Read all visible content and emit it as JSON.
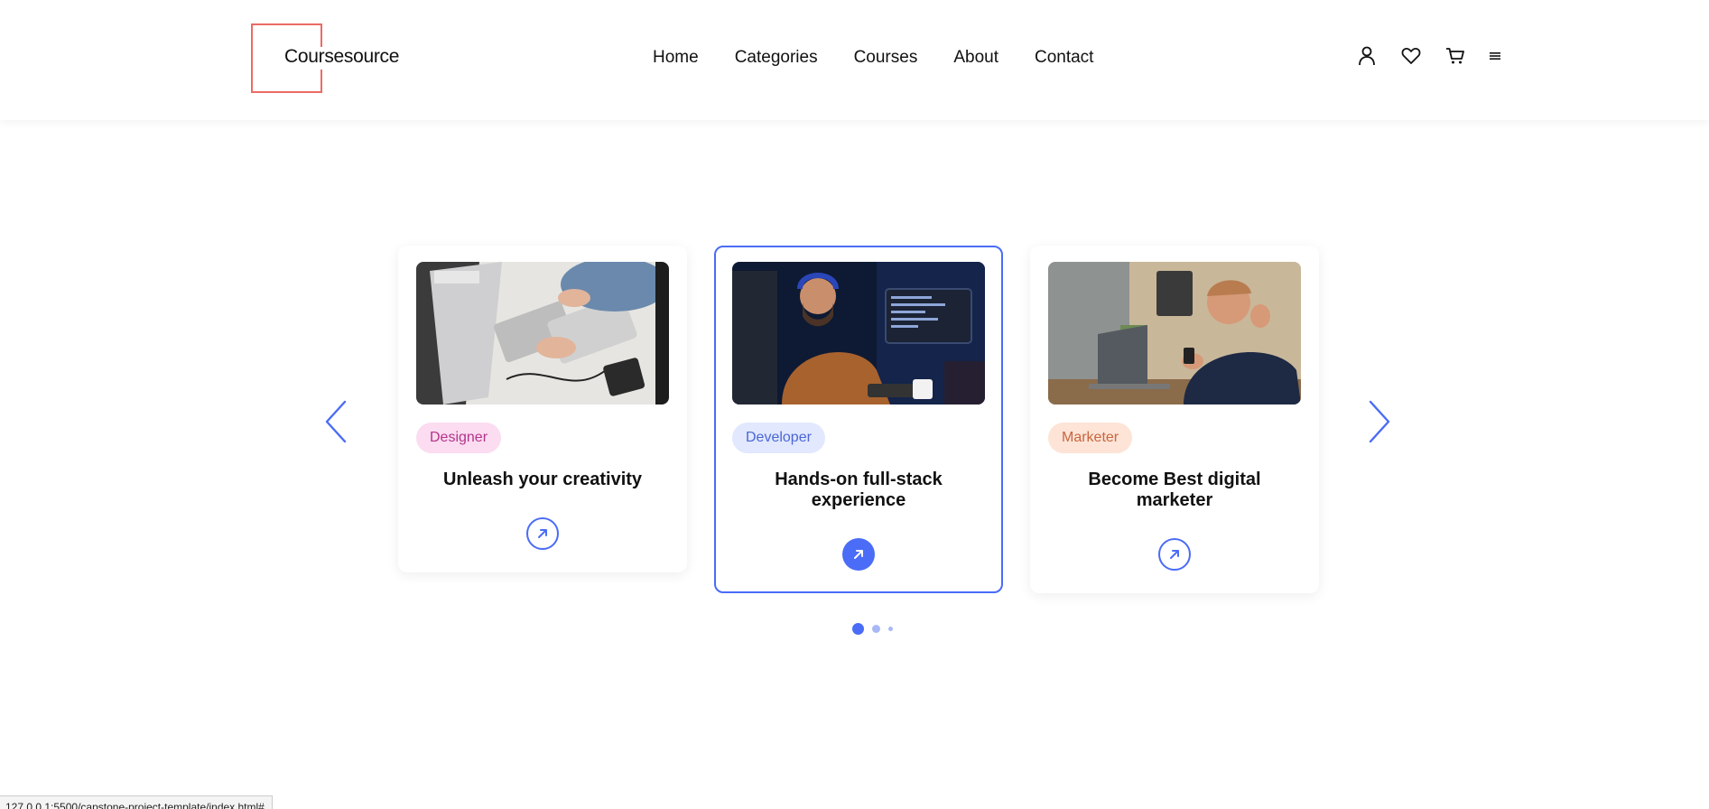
{
  "header": {
    "logo_text": "Coursesource",
    "nav": [
      "Home",
      "Categories",
      "Courses",
      "About",
      "Contact"
    ],
    "icons": [
      "user-icon",
      "heart-icon",
      "cart-icon",
      "menu-icon"
    ]
  },
  "slider": {
    "cards": [
      {
        "tag": "Designer",
        "title": "Unleash your creativity",
        "image": "person-drawing-on-tablet-image",
        "tag_color": "#b5338a"
      },
      {
        "tag": "Developer",
        "title": "Hands-on full-stack experience",
        "image": "developer-with-headphones-image",
        "tag_color": "#4a66d6"
      },
      {
        "tag": "Marketer",
        "title": "Become Best digital marketer",
        "image": "man-celebrating-at-laptop-image",
        "tag_color": "#c8663f"
      }
    ],
    "active_card": 2,
    "pagination_active": 1,
    "pagination_count": 3
  },
  "status_bar": {
    "url": "127.0.0.1:5500/capstone-project-template/index.html#"
  },
  "colors": {
    "accent": "#4a6cf7",
    "logo": "#ec6a66"
  }
}
